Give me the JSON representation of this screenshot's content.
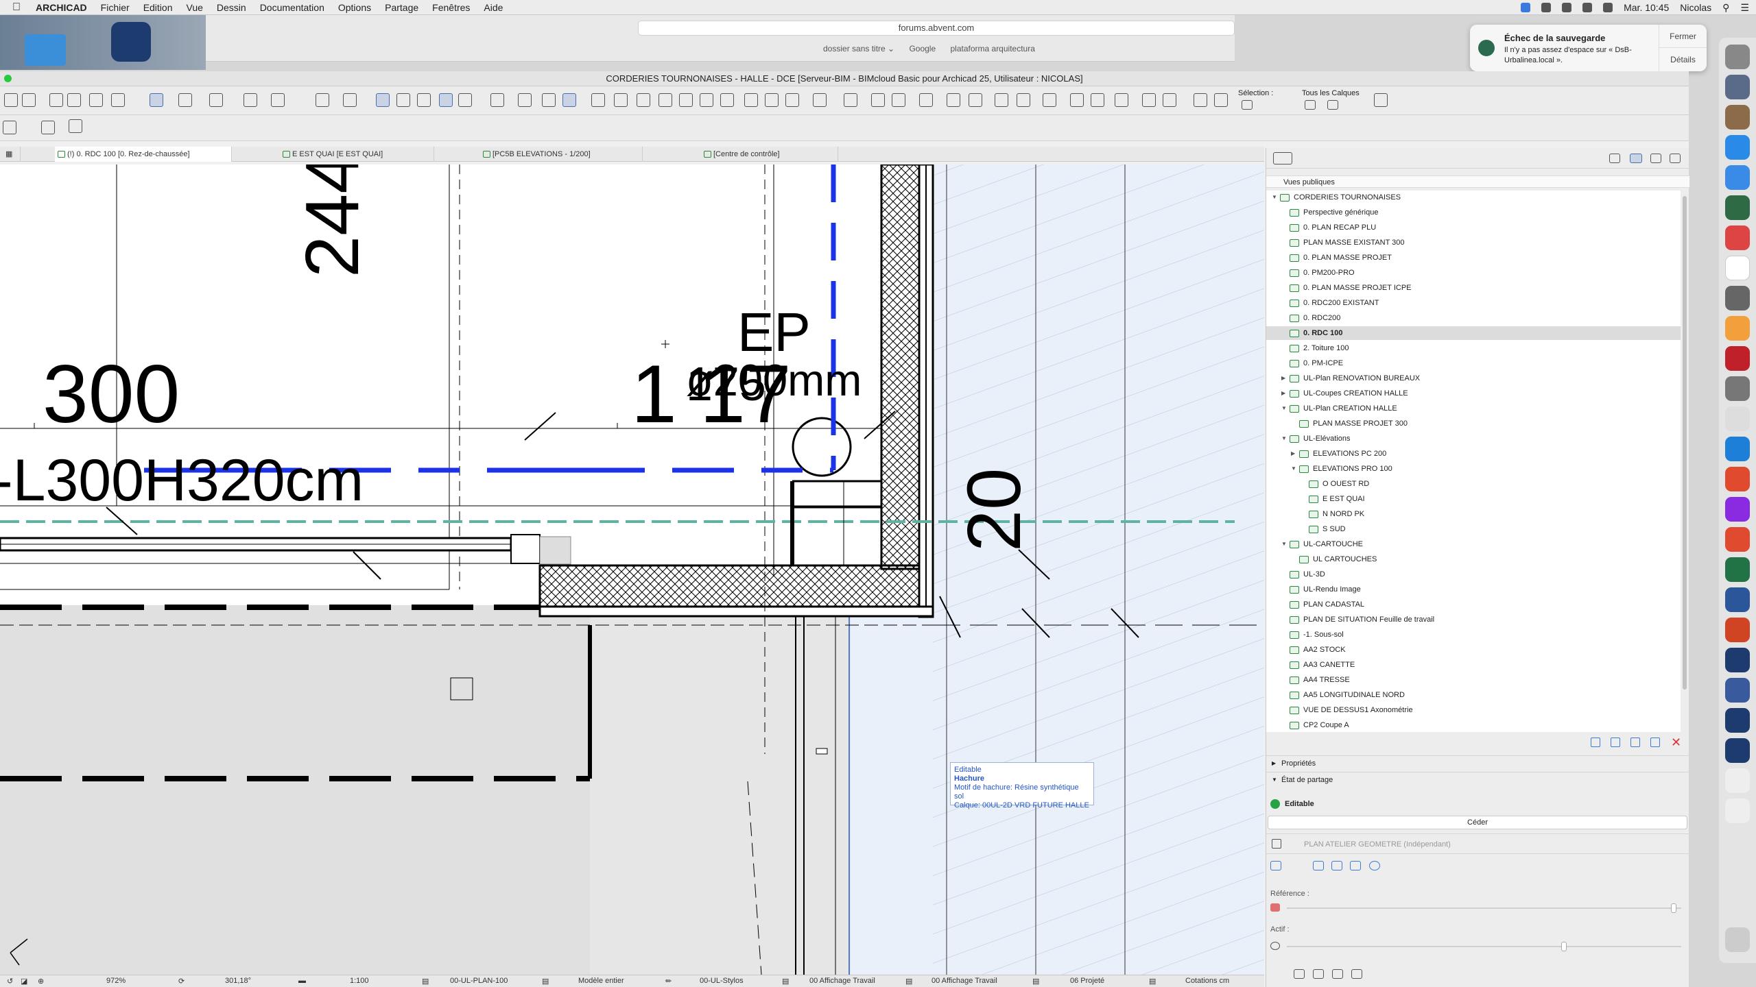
{
  "menubar": {
    "app": "ARCHICAD",
    "items": [
      "Fichier",
      "Edition",
      "Vue",
      "Dessin",
      "Documentation",
      "Options",
      "Partage",
      "Fenêtres",
      "Aide"
    ],
    "clock": "Mar. 10:45",
    "user": "Nicolas"
  },
  "safari": {
    "url": "forums.abvent.com",
    "favorites": [
      "dossier sans titre ⌄",
      "Google",
      "plataforma arquitectura"
    ]
  },
  "notification": {
    "title": "Échec de la sauvegarde",
    "body": "Il n'y a pas assez d'espace sur « DsB-Urbalinea.local ».",
    "close": "Fermer",
    "details": "Détails"
  },
  "window": {
    "title": "CORDERIES TOURNONAISES - HALLE - DCE [Serveur-BIM - BIMcloud Basic pour Archicad 25, Utilisateur : NICOLAS]"
  },
  "toolbar": {
    "selection_label": "Sélection :",
    "calques_label": "Tous les Calques"
  },
  "tabs": [
    "(!) 0. RDC 100 [0. Rez-de-chaussée]",
    "E EST QUAI [E EST QUAI]",
    "[PC5B ELEVATIONS - 1/200]",
    "[Centre de contrôle]"
  ],
  "drawing": {
    "dim_244": "244",
    "dim_300": "300",
    "dim_117": "1 17",
    "dim_175": "175",
    "ep_label": "EP",
    "pipe_label": "ø200mm",
    "beam_label": "-L300H320cm",
    "dim_20": "20"
  },
  "tooltip": {
    "status": "Editable",
    "type": "Hachure",
    "pattern": "Motif de hachure: Résine synthétique sol",
    "layer": "Calque: 00UL-2D VRD FUTURE HALLE"
  },
  "statusbar": {
    "zoom": "972%",
    "angle": "301,18°",
    "scale": "1:100",
    "layer_combo": "00-UL-PLAN-100",
    "model": "Modèle entier",
    "pens": "00-UL-Stylos",
    "mvo": "00 Affichage Travail",
    "graphic": "00 Affichage Travail",
    "renovation": "06 Projeté",
    "dimension": "Cotations cm"
  },
  "navigator": {
    "public_views": "Vues publiques",
    "tree": [
      {
        "label": "CORDERIES TOURNONAISES",
        "level": 0,
        "toggle": "▼"
      },
      {
        "label": "Perspective générique",
        "level": 1
      },
      {
        "label": "0. PLAN RECAP PLU",
        "level": 1
      },
      {
        "label": "PLAN MASSE EXISTANT 300",
        "level": 1
      },
      {
        "label": "0. PLAN MASSE PROJET",
        "level": 1
      },
      {
        "label": "0. PM200-PRO",
        "level": 1
      },
      {
        "label": "0. PLAN MASSE PROJET ICPE",
        "level": 1
      },
      {
        "label": "0. RDC200 EXISTANT",
        "level": 1
      },
      {
        "label": "0. RDC200",
        "level": 1
      },
      {
        "label": "0. RDC 100",
        "level": 1,
        "selected": true
      },
      {
        "label": "2. Toiture 100",
        "level": 1
      },
      {
        "label": "0. PM-ICPE",
        "level": 1
      },
      {
        "label": "UL-Plan RENOVATION BUREAUX",
        "level": 1,
        "toggle": "▶"
      },
      {
        "label": "UL-Coupes CREATION HALLE",
        "level": 1,
        "toggle": "▶"
      },
      {
        "label": "UL-Plan CREATION HALLE",
        "level": 1,
        "toggle": "▼"
      },
      {
        "label": "PLAN MASSE PROJET 300",
        "level": 2
      },
      {
        "label": "UL-Elévations",
        "level": 1,
        "toggle": "▼"
      },
      {
        "label": "ELEVATIONS PC 200",
        "level": 2,
        "toggle": "▶"
      },
      {
        "label": "ELEVATIONS PRO 100",
        "level": 2,
        "toggle": "▼"
      },
      {
        "label": "O OUEST RD",
        "level": 3
      },
      {
        "label": "E EST QUAI",
        "level": 3
      },
      {
        "label": "N NORD PK",
        "level": 3
      },
      {
        "label": "S SUD",
        "level": 3
      },
      {
        "label": "UL-CARTOUCHE",
        "level": 1,
        "toggle": "▼"
      },
      {
        "label": "UL CARTOUCHES",
        "level": 2
      },
      {
        "label": "UL-3D",
        "level": 1
      },
      {
        "label": "UL-Rendu Image",
        "level": 1
      },
      {
        "label": "PLAN CADASTAL",
        "level": 1
      },
      {
        "label": "PLAN DE SITUATION  Feuille de travail",
        "level": 1
      },
      {
        "label": "-1. Sous-sol",
        "level": 1
      },
      {
        "label": "AA2 STOCK",
        "level": 1
      },
      {
        "label": "AA3 CANETTE",
        "level": 1
      },
      {
        "label": "AA4 TRESSE",
        "level": 1
      },
      {
        "label": "AA5 LONGITUDINALE NORD",
        "level": 1
      },
      {
        "label": "VUE DE DESSUS1 Axonométrie",
        "level": 1
      },
      {
        "label": "CP2 Coupe A",
        "level": 1
      }
    ],
    "properties": "Propriétés",
    "sharing": "État de partage",
    "editable": "Editable",
    "ceder": "Céder",
    "atelier": "PLAN ATELIER GEOMETRE (Indépendant)",
    "reference": "Référence :",
    "actif": "Actif :"
  },
  "colors": {
    "accent": "#1a33e6",
    "hatch_fill": "#e9f0fa",
    "teal_line": "#5fb3a3",
    "editable_green": "#27a345"
  }
}
